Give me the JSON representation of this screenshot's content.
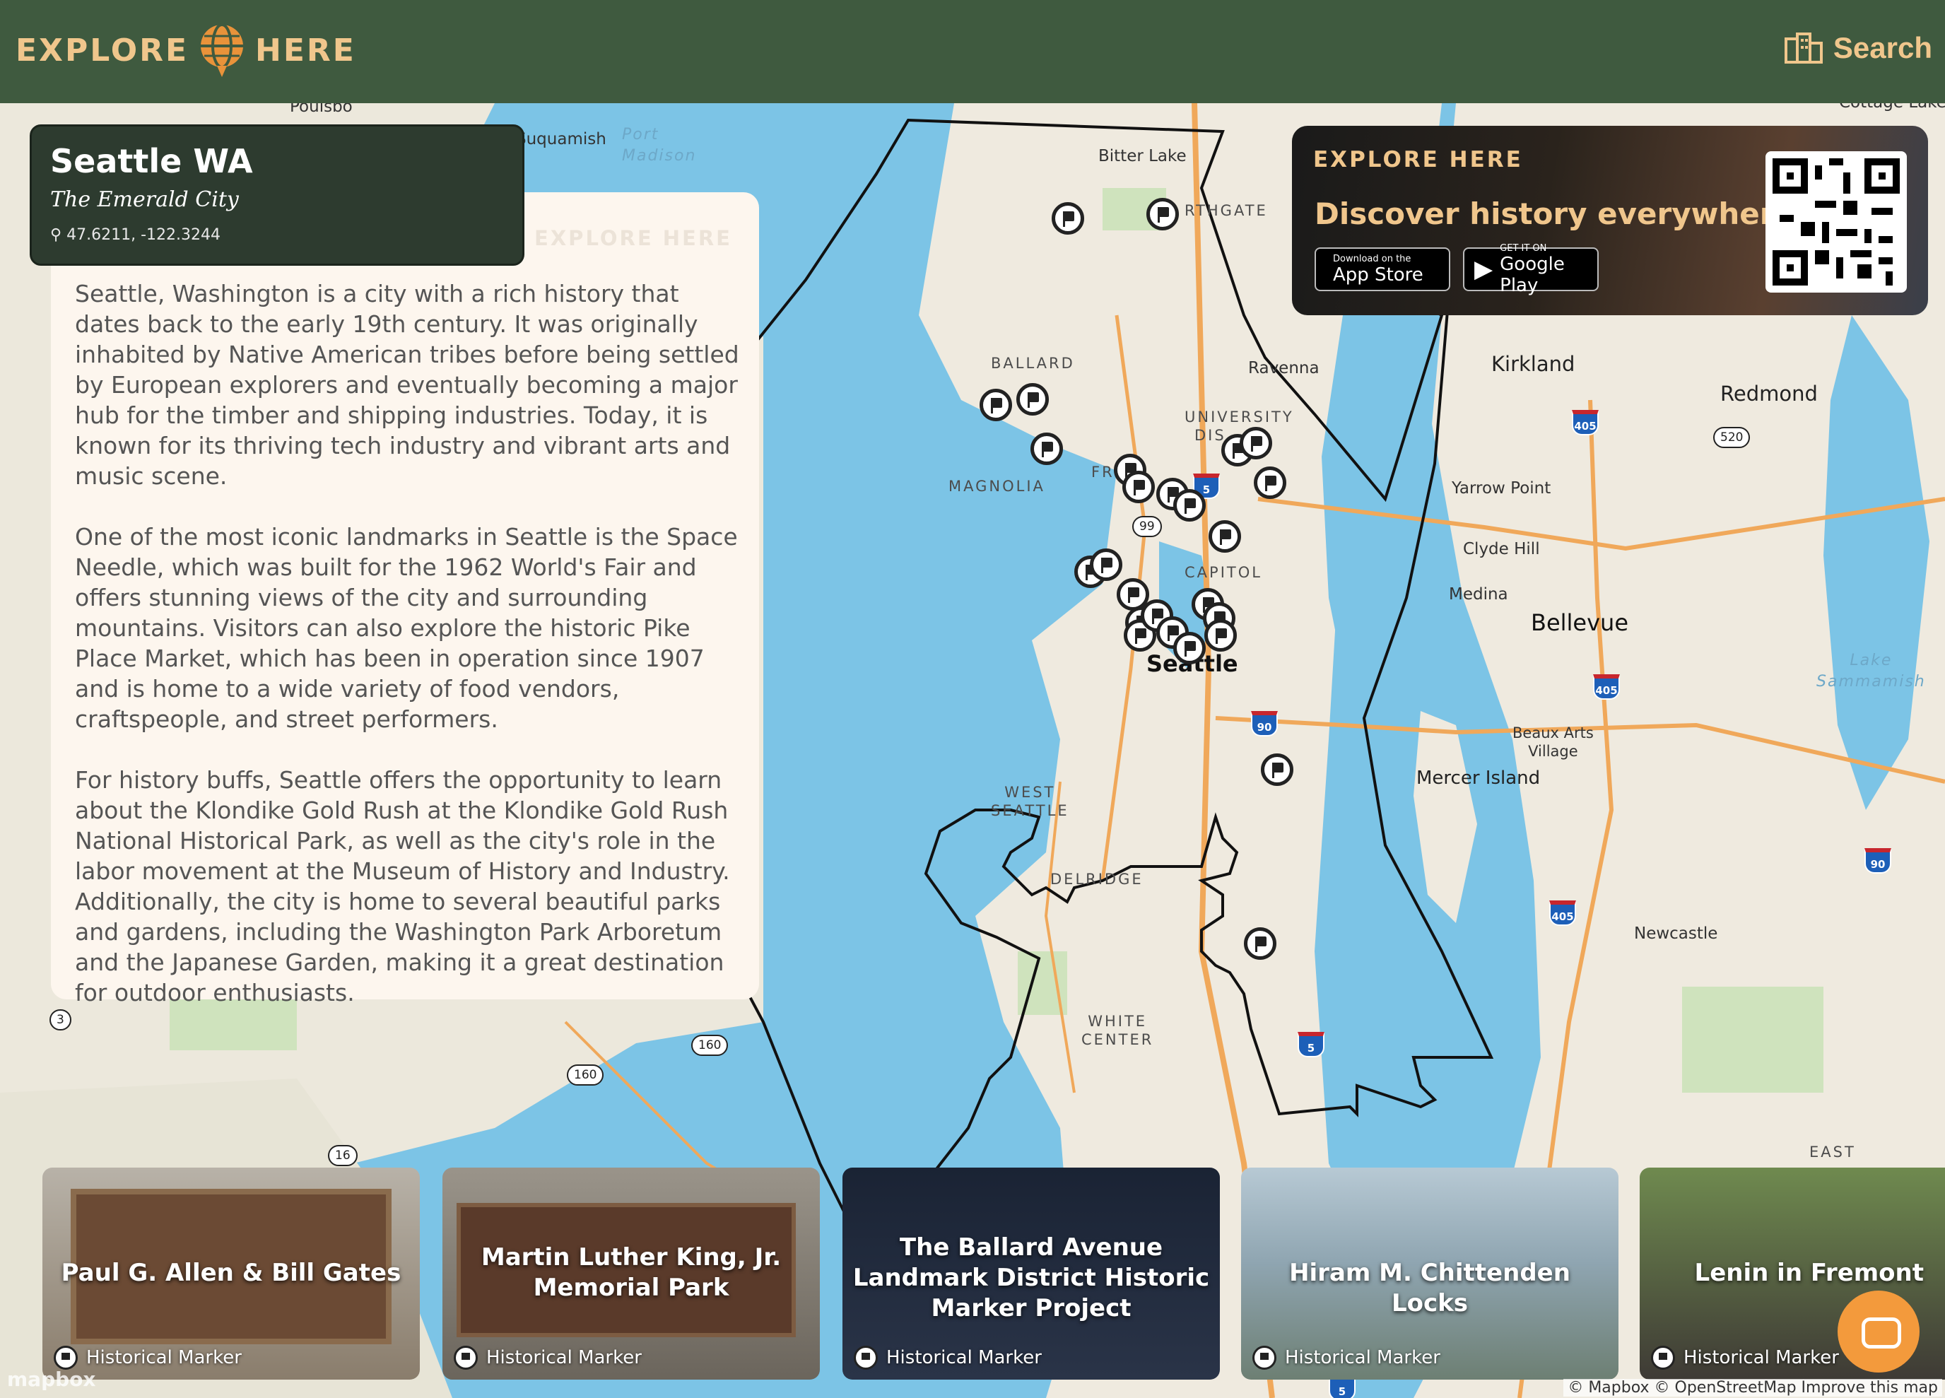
{
  "header": {
    "logo_left": "EXPLORE",
    "logo_right": "HERE",
    "search_label": "Search"
  },
  "location": {
    "title": "Seattle WA",
    "subtitle": "The Emerald City",
    "coords": "47.6211, -122.3244"
  },
  "description": {
    "watermark": "EXPLORE HERE",
    "paragraphs": [
      "Seattle, Washington is a city with a rich history that dates back to the early 19th century. It was originally inhabited by Native American tribes before being settled by European explorers and eventually becoming a major hub for the timber and shipping industries. Today, it is known for its thriving tech industry and vibrant arts and music scene.",
      "One of the most iconic landmarks in Seattle is the Space Needle, which was built for the 1962 World's Fair and offers stunning views of the city and surrounding mountains. Visitors can also explore the historic Pike Place Market, which has been in operation since 1907 and is home to a wide variety of food vendors, craftspeople, and street performers.",
      "For history buffs, Seattle offers the opportunity to learn about the Klondike Gold Rush at the Klondike Gold Rush National Historical Park, as well as the city's role in the labor movement at the Museum of History and Industry. Additionally, the city is home to several beautiful parks and gardens, including the Washington Park Arboretum and the Japanese Garden, making it a great destination for outdoor enthusiasts."
    ]
  },
  "promo": {
    "logo": "EXPLORE HERE",
    "headline": "Discover history everywhere",
    "appstore_small": "Download on the",
    "appstore_large": "App Store",
    "googleplay_small": "GET IT ON",
    "googleplay_large": "Google Play"
  },
  "map_labels": {
    "poulsbo": "Poulsbo",
    "suquamish": "Suquamish",
    "port_madison": "Port\nMadison",
    "bitter_lake": "Bitter Lake",
    "northgate": "RTHGATE",
    "ballard": "BALLARD",
    "ravenna": "Ravenna",
    "university": "UNIVERSITY",
    "dis": "DIS",
    "magnolia": "MAGNOLIA",
    "fremont": "FR",
    "capitol": "CAPITOL",
    "seattle": "Seattle",
    "west_seattle": "WEST\nSEATTLE",
    "delridge": "DELRIDGE",
    "white_center": "WHITE\nCENTER",
    "kirkland": "Kirkland",
    "redmond": "Redmond",
    "yarrow_point": "Yarrow Point",
    "clyde_hill": "Clyde Hill",
    "medina": "Medina",
    "bellevue": "Bellevue",
    "lake_sammamish": "Lake\nSammamish",
    "beaux_arts": "Beaux Arts\nVillage",
    "mercer_island": "Mercer Island",
    "newcastle": "Newcastle",
    "east_renton": "EAST",
    "cottage_lake": "Cottage Lake"
  },
  "shields": [
    "405",
    "520",
    "405",
    "90",
    "90",
    "405",
    "5",
    "5",
    "5"
  ],
  "routes": [
    "99",
    "3",
    "160",
    "160",
    "16"
  ],
  "cards": [
    {
      "title": "Paul G. Allen & Bill Gates",
      "tag": "Historical Marker"
    },
    {
      "title": "Martin Luther King, Jr. Memorial Park",
      "tag": "Historical Marker"
    },
    {
      "title": "The Ballard Avenue Landmark District Historic Marker Project",
      "tag": "Historical Marker"
    },
    {
      "title": "Hiram M. Chittenden Locks",
      "tag": "Historical Marker"
    },
    {
      "title": "Lenin in Fremont",
      "tag": "Historical Marker"
    }
  ],
  "attribution": "© Mapbox © OpenStreetMap  Improve this map",
  "mapbox": "mapbox",
  "colors": {
    "header_bg": "#3f5a3f",
    "accent": "#f0c68c",
    "water": "#7cc4e6",
    "land": "#efeadf",
    "card_dark": "#2d3b2f",
    "desc_bg": "#fdf6ee",
    "chat": "#f39a3c"
  }
}
